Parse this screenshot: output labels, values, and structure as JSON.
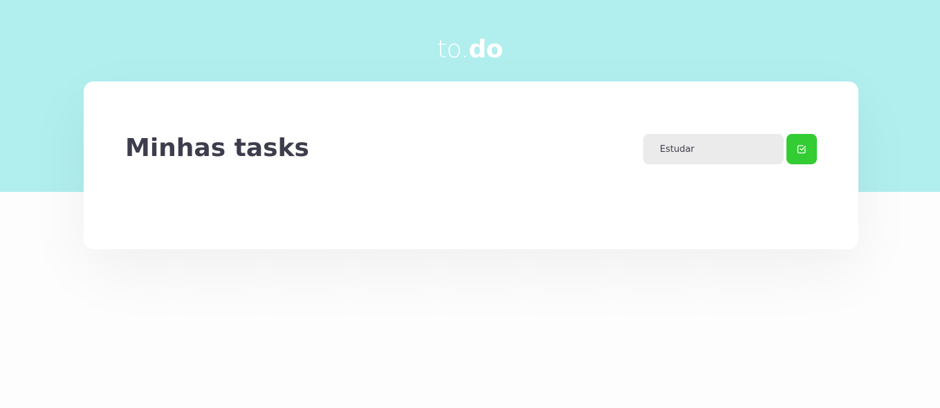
{
  "header": {
    "logo_light": "to.",
    "logo_bold": "do"
  },
  "main": {
    "title": "Minhas tasks",
    "task_input": {
      "value": "Estudar",
      "placeholder": ""
    },
    "add_button": {
      "icon": "check-square-icon"
    }
  },
  "colors": {
    "header_background": "#b1eeee",
    "page_background": "#fdfdfd",
    "card_background": "#ffffff",
    "title_text": "#3d3d4d",
    "input_background": "#ebebeb",
    "accent_button": "#33cc33"
  }
}
